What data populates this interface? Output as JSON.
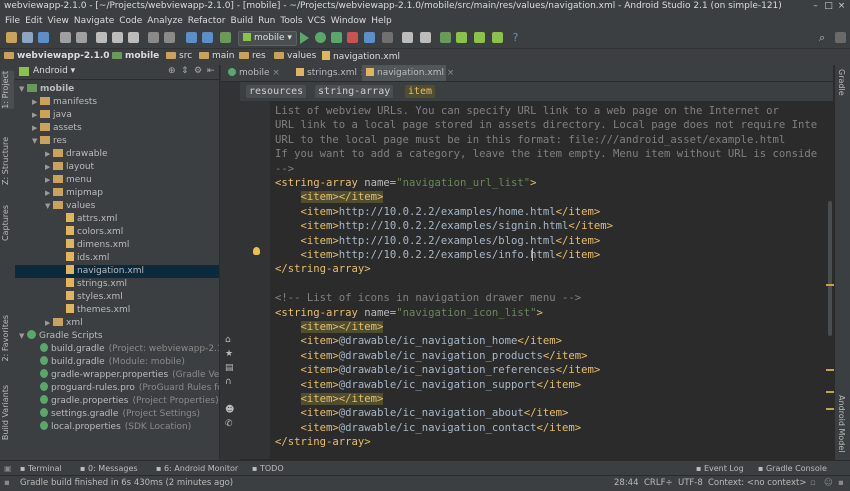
{
  "window": {
    "title": "webviewapp-2.1.0 - [~/Projects/webviewapp-2.1.0] - [mobile] - ~/Projects/webviewapp-2.1.0/mobile/src/main/res/values/navigation.xml - Android Studio 2.1 (on simple-121)"
  },
  "menu": [
    "File",
    "Edit",
    "View",
    "Navigate",
    "Code",
    "Analyze",
    "Refactor",
    "Build",
    "Run",
    "Tools",
    "VCS",
    "Window",
    "Help"
  ],
  "toolbar": {
    "run_config": "mobile"
  },
  "breadcrumbs": [
    "webviewapp-2.1.0",
    "mobile",
    "src",
    "main",
    "res",
    "values",
    "navigation.xml"
  ],
  "left_strip": {
    "project": "1: Project",
    "structure": "Z: Structure",
    "captures": "Captures",
    "favorites": "2: Favorites",
    "build_variants": "Build Variants"
  },
  "project_panel": {
    "view_mode": "Android"
  },
  "tree": [
    {
      "label": "mobile",
      "indent": 0,
      "open": true,
      "type": "module"
    },
    {
      "label": "manifests",
      "indent": 1,
      "open": false,
      "type": "folder"
    },
    {
      "label": "java",
      "indent": 1,
      "open": false,
      "type": "folder"
    },
    {
      "label": "assets",
      "indent": 1,
      "open": false,
      "type": "folder"
    },
    {
      "label": "res",
      "indent": 1,
      "open": true,
      "type": "folder"
    },
    {
      "label": "drawable",
      "indent": 2,
      "open": false,
      "type": "folder"
    },
    {
      "label": "layout",
      "indent": 2,
      "open": false,
      "type": "folder"
    },
    {
      "label": "menu",
      "indent": 2,
      "open": false,
      "type": "folder"
    },
    {
      "label": "mipmap",
      "indent": 2,
      "open": false,
      "type": "folder"
    },
    {
      "label": "values",
      "indent": 2,
      "open": true,
      "type": "folder"
    },
    {
      "label": "attrs.xml",
      "indent": 3,
      "type": "file"
    },
    {
      "label": "colors.xml",
      "indent": 3,
      "type": "file"
    },
    {
      "label": "dimens.xml",
      "indent": 3,
      "type": "file"
    },
    {
      "label": "ids.xml",
      "indent": 3,
      "type": "file"
    },
    {
      "label": "navigation.xml",
      "indent": 3,
      "type": "file",
      "selected": true
    },
    {
      "label": "strings.xml",
      "indent": 3,
      "type": "file"
    },
    {
      "label": "styles.xml",
      "indent": 3,
      "type": "file"
    },
    {
      "label": "themes.xml",
      "indent": 3,
      "type": "file"
    },
    {
      "label": "xml",
      "indent": 2,
      "open": false,
      "type": "folder"
    },
    {
      "label": "Gradle Scripts",
      "indent": 0,
      "open": true,
      "type": "gradle"
    },
    {
      "label": "build.gradle",
      "note": "(Project: webviewapp-2.1.0",
      "indent": 1,
      "type": "gradle-file"
    },
    {
      "label": "build.gradle",
      "note": "(Module: mobile)",
      "indent": 1,
      "type": "gradle-file"
    },
    {
      "label": "gradle-wrapper.properties",
      "note": "(Gradle Vers",
      "indent": 1,
      "type": "gradle-file"
    },
    {
      "label": "proguard-rules.pro",
      "note": "(ProGuard Rules for",
      "indent": 1,
      "type": "gradle-file"
    },
    {
      "label": "gradle.properties",
      "note": "(Project Properties)",
      "indent": 1,
      "type": "gradle-file"
    },
    {
      "label": "settings.gradle",
      "note": "(Project Settings)",
      "indent": 1,
      "type": "gradle-file"
    },
    {
      "label": "local.properties",
      "note": "(SDK Location)",
      "indent": 1,
      "type": "gradle-file"
    }
  ],
  "editor_tabs": [
    {
      "label": "mobile",
      "active": false
    },
    {
      "label": "strings.xml",
      "active": false
    },
    {
      "label": "navigation.xml",
      "active": true
    }
  ],
  "xml_breadcrumb": [
    "resources",
    "string-array",
    "item"
  ],
  "code_lines": [
    [
      {
        "t": "List of ",
        "c": "cm"
      },
      {
        "t": "webview",
        "c": "cm"
      },
      {
        "t": " URLs. You can specify URL link to a web page on the Internet or",
        "c": "cm"
      }
    ],
    [
      {
        "t": "URL link to a local page stored in assets directory. Local page does not require Inte",
        "c": "cm"
      }
    ],
    [
      {
        "t": "URL to the local page must be in this format: file:///android_asset/example.html",
        "c": "cm"
      }
    ],
    [
      {
        "t": "If you want to add a category, leave the item empty. Menu item without URL is conside",
        "c": "cm"
      }
    ],
    [
      {
        "t": "-->",
        "c": "cm"
      }
    ],
    [
      {
        "t": "<string-array ",
        "c": "tg"
      },
      {
        "t": "name=",
        "c": "at"
      },
      {
        "t": "\"navigation_url_list\"",
        "c": "sv"
      },
      {
        "t": ">",
        "c": "tg"
      }
    ],
    [
      {
        "t": "    ",
        "c": ""
      },
      {
        "t": "<item></item>",
        "c": "hl"
      }
    ],
    [
      {
        "t": "    ",
        "c": ""
      },
      {
        "t": "<item>",
        "c": "tg"
      },
      {
        "t": "http://10.0.2.2/examples/home.html",
        "c": ""
      },
      {
        "t": "</item>",
        "c": "tg"
      }
    ],
    [
      {
        "t": "    ",
        "c": ""
      },
      {
        "t": "<item>",
        "c": "tg"
      },
      {
        "t": "http://10.0.2.2/examples/signin.html",
        "c": ""
      },
      {
        "t": "</item>",
        "c": "tg"
      }
    ],
    [
      {
        "t": "    ",
        "c": ""
      },
      {
        "t": "<item>",
        "c": "tg"
      },
      {
        "t": "http://10.0.2.2/examples/blog.html",
        "c": ""
      },
      {
        "t": "</item>",
        "c": "tg"
      }
    ],
    [
      {
        "t": "    ",
        "c": ""
      },
      {
        "t": "<item>",
        "c": "tg"
      },
      {
        "t": "http://10.0.2.2/examples/info.html",
        "c": ""
      },
      {
        "t": "</item>",
        "c": "tg"
      }
    ],
    [
      {
        "t": "</string-array>",
        "c": "tg"
      }
    ],
    [
      {
        "t": "",
        "c": ""
      }
    ],
    [
      {
        "t": "<!-- List of icons in navigation drawer menu -->",
        "c": "cm"
      }
    ],
    [
      {
        "t": "<string-array ",
        "c": "tg"
      },
      {
        "t": "name=",
        "c": "at"
      },
      {
        "t": "\"navigation_icon_list\"",
        "c": "sv"
      },
      {
        "t": ">",
        "c": "tg"
      }
    ],
    [
      {
        "t": "    ",
        "c": ""
      },
      {
        "t": "<item></item>",
        "c": "hl"
      }
    ],
    [
      {
        "t": "    ",
        "c": ""
      },
      {
        "t": "<item>",
        "c": "tg"
      },
      {
        "t": "@drawable/ic_navigation_home",
        "c": ""
      },
      {
        "t": "</item>",
        "c": "tg"
      }
    ],
    [
      {
        "t": "    ",
        "c": ""
      },
      {
        "t": "<item>",
        "c": "tg"
      },
      {
        "t": "@drawable/ic_navigation_products",
        "c": ""
      },
      {
        "t": "</item>",
        "c": "tg"
      }
    ],
    [
      {
        "t": "    ",
        "c": ""
      },
      {
        "t": "<item>",
        "c": "tg"
      },
      {
        "t": "@drawable/ic_navigation_references",
        "c": ""
      },
      {
        "t": "</item>",
        "c": "tg"
      }
    ],
    [
      {
        "t": "    ",
        "c": ""
      },
      {
        "t": "<item>",
        "c": "tg"
      },
      {
        "t": "@drawable/ic_navigation_support",
        "c": ""
      },
      {
        "t": "</item>",
        "c": "tg"
      }
    ],
    [
      {
        "t": "    ",
        "c": ""
      },
      {
        "t": "<item></item>",
        "c": "hl"
      }
    ],
    [
      {
        "t": "    ",
        "c": ""
      },
      {
        "t": "<item>",
        "c": "tg"
      },
      {
        "t": "@drawable/ic_navigation_about",
        "c": ""
      },
      {
        "t": "</item>",
        "c": "tg"
      }
    ],
    [
      {
        "t": "    ",
        "c": ""
      },
      {
        "t": "<item>",
        "c": "tg"
      },
      {
        "t": "@drawable/ic_navigation_contact",
        "c": ""
      },
      {
        "t": "</item>",
        "c": "tg"
      }
    ],
    [
      {
        "t": "</string-array>",
        "c": "tg"
      }
    ]
  ],
  "right_strip": {
    "gradle": "Gradle",
    "android_model": "Android Model"
  },
  "bottom_tabs": {
    "terminal": "Terminal",
    "messages": "0: Messages",
    "android_monitor": "6: Android Monitor",
    "todo": "TODO",
    "event_log": "Event Log",
    "gradle_console": "Gradle Console"
  },
  "status": {
    "message": "Gradle build finished in 6s 430ms (2 minutes ago)",
    "position": "28:44",
    "line_sep": "CRLF÷",
    "encoding": "UTF-8",
    "context": "Context: <no context>"
  },
  "colors": {
    "bg": "#2b2b2b",
    "panel": "#3c3f41",
    "selection": "#0d293e",
    "tag": "#e8bf6a",
    "string": "#6a8759",
    "comment": "#808080"
  }
}
